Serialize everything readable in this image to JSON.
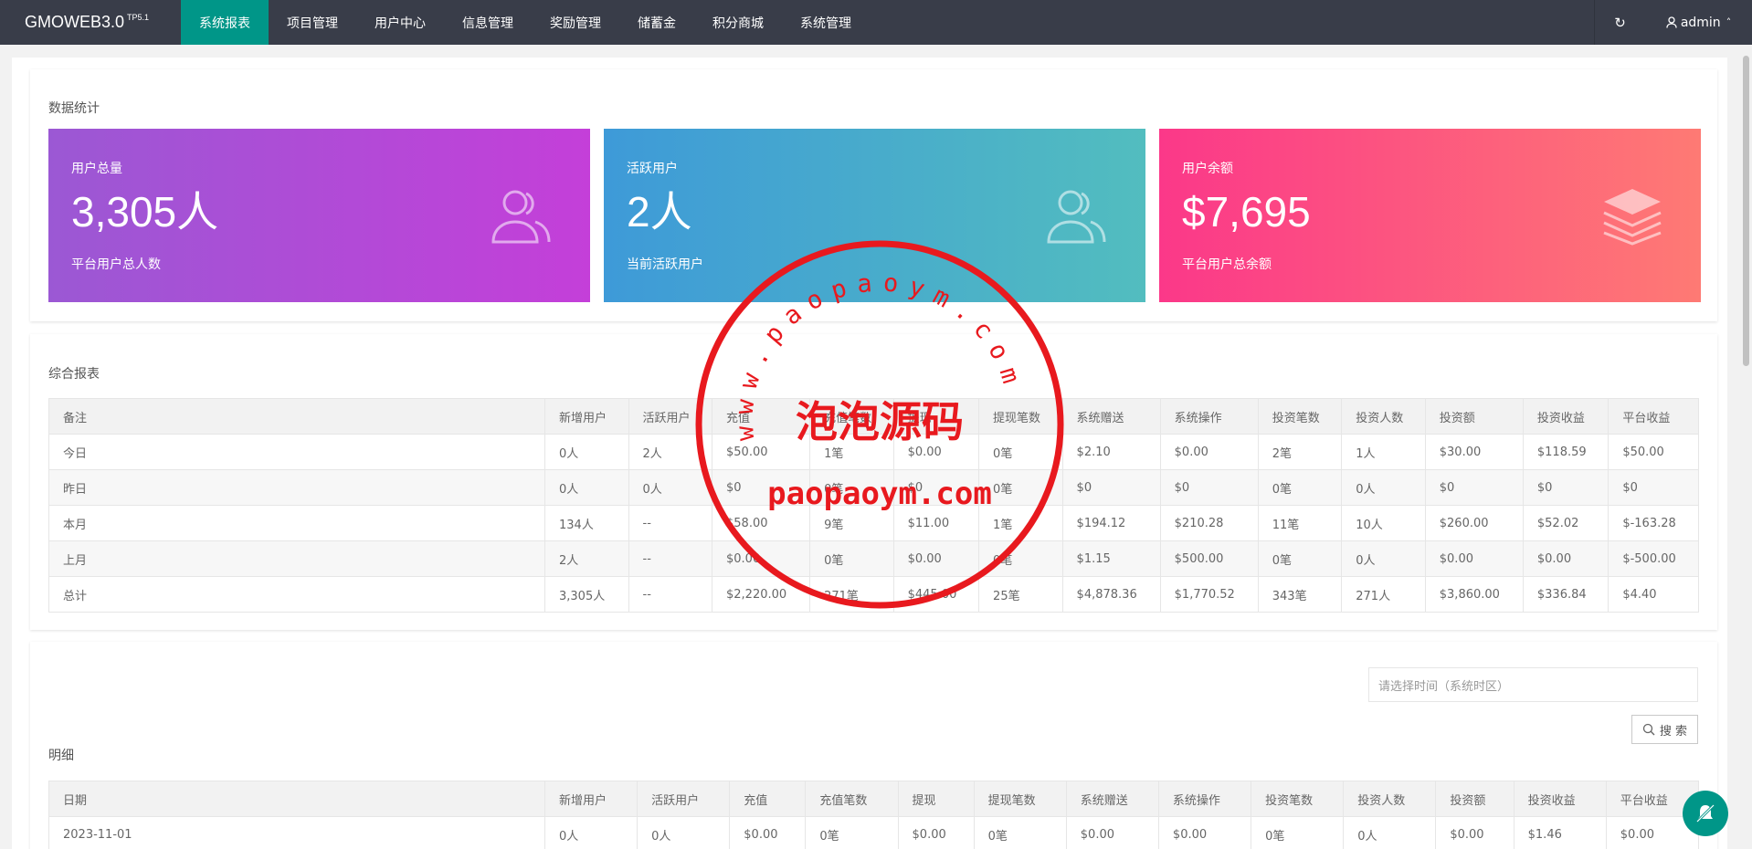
{
  "header": {
    "logo": "GMOWEB3.0",
    "logo_sup": "TP5.1",
    "nav": [
      "系统报表",
      "项目管理",
      "用户中心",
      "信息管理",
      "奖励管理",
      "储蓄金",
      "积分商城",
      "系统管理"
    ],
    "active_nav": "系统报表",
    "refresh_icon": "refresh-icon",
    "user": "admin"
  },
  "stats": {
    "title": "数据统计",
    "tiles": [
      {
        "label": "用户总量",
        "value": "3,305人",
        "sub": "平台用户总人数",
        "icon": "users-icon"
      },
      {
        "label": "活跃用户",
        "value": "2人",
        "sub": "当前活跃用户",
        "icon": "users-icon"
      },
      {
        "label": "用户余额",
        "value": "$7,695",
        "sub": "平台用户总余额",
        "icon": "stack-icon"
      }
    ]
  },
  "report": {
    "title": "综合报表",
    "columns": [
      "备注",
      "新增用户",
      "活跃用户",
      "充值",
      "充值笔数",
      "提现",
      "提现笔数",
      "系统赠送",
      "系统操作",
      "投资笔数",
      "投资人数",
      "投资额",
      "投资收益",
      "平台收益"
    ],
    "rows": [
      [
        "今日",
        "0人",
        "2人",
        "$50.00",
        "1笔",
        "$0.00",
        "0笔",
        "$2.10",
        "$0.00",
        "2笔",
        "1人",
        "$30.00",
        "$118.59",
        "$50.00"
      ],
      [
        "昨日",
        "0人",
        "0人",
        "$0",
        "0笔",
        "$0",
        "0笔",
        "$0",
        "$0",
        "0笔",
        "0人",
        "$0",
        "$0",
        "$0"
      ],
      [
        "本月",
        "134人",
        "--",
        "$58.00",
        "9笔",
        "$11.00",
        "1笔",
        "$194.12",
        "$210.28",
        "11笔",
        "10人",
        "$260.00",
        "$52.02",
        "$-163.28"
      ],
      [
        "上月",
        "2人",
        "--",
        "$0.00",
        "0笔",
        "$0.00",
        "0笔",
        "$1.15",
        "$500.00",
        "0笔",
        "0人",
        "$0.00",
        "$0.00",
        "$-500.00"
      ],
      [
        "总计",
        "3,305人",
        "--",
        "$2,220.00",
        "271笔",
        "$445.00",
        "25笔",
        "$4,878.36",
        "$1,770.52",
        "343笔",
        "271人",
        "$3,860.00",
        "$336.84",
        "$4.40"
      ]
    ]
  },
  "detail": {
    "title": "明细",
    "date_placeholder": "请选择时间（系统时区）",
    "search_label": "搜 索",
    "columns": [
      "日期",
      "新增用户",
      "活跃用户",
      "充值",
      "充值笔数",
      "提现",
      "提现笔数",
      "系统赠送",
      "系统操作",
      "投资笔数",
      "投资人数",
      "投资额",
      "投资收益",
      "平台收益"
    ],
    "rows": [
      [
        "2023-11-01",
        "0人",
        "0人",
        "$0.00",
        "0笔",
        "$0.00",
        "0笔",
        "$0.00",
        "$0.00",
        "0笔",
        "0人",
        "$0.00",
        "$1.46",
        "$0.00"
      ]
    ]
  },
  "watermark": {
    "ring_text": "www.paopaoym.com",
    "center_text": "泡泡源码",
    "bottom_text": "paopaoym.com",
    "color": "#e8191e"
  },
  "colors": {
    "header_bg": "#393d49",
    "active_nav": "#009688"
  }
}
